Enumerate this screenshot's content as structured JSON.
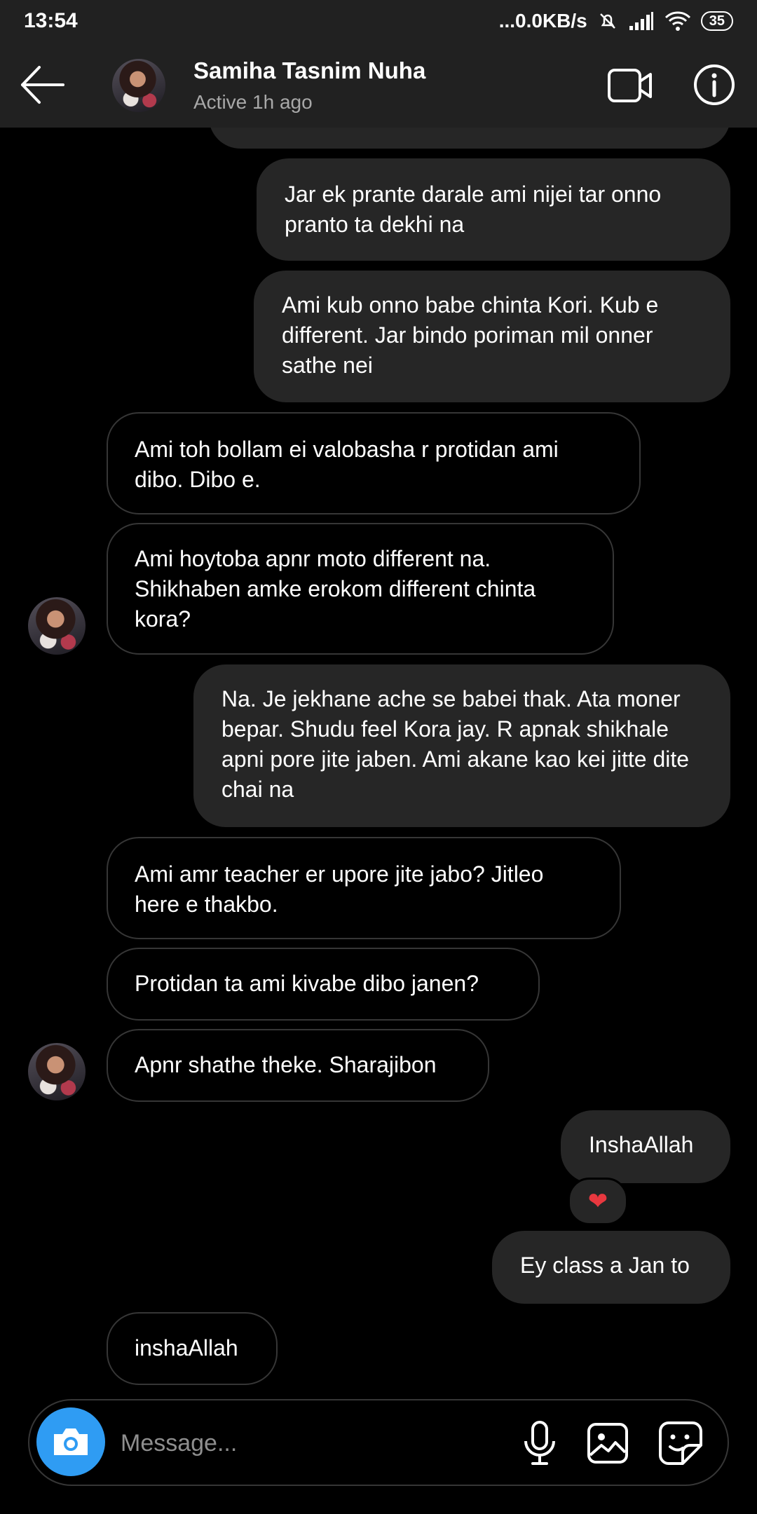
{
  "status_bar": {
    "time": "13:54",
    "network_speed": "...0.0KB/s",
    "battery": "35"
  },
  "header": {
    "contact_name": "Samiha Tasnim Nuha",
    "active_status": "Active 1h ago"
  },
  "messages": [
    {
      "direction": "outgoing",
      "text": "Jar ek prante darale ami nijei tar onno pranto ta dekhi na"
    },
    {
      "direction": "outgoing",
      "text": "Ami kub onno babe chinta Kori. Kub e different. Jar bindo poriman mil onner sathe nei"
    },
    {
      "direction": "incoming",
      "text": "Ami toh bollam ei valobasha r protidan ami dibo. Dibo e."
    },
    {
      "direction": "incoming",
      "text": "Ami hoytoba apnr moto different na. Shikhaben amke erokom different chinta kora?"
    },
    {
      "direction": "outgoing",
      "text": "Na. Je jekhane ache se babei thak. Ata moner bepar. Shudu feel Kora jay. R apnak shikhale apni pore jite jaben. Ami akane kao kei jitte dite chai na"
    },
    {
      "direction": "incoming",
      "text": "Ami amr teacher er upore jite jabo? Jitleo here e thakbo."
    },
    {
      "direction": "incoming",
      "text": "Protidan ta ami kivabe dibo janen?"
    },
    {
      "direction": "incoming",
      "text": "Apnr shathe theke. Sharajibon"
    },
    {
      "direction": "outgoing",
      "text": "InshaAllah"
    },
    {
      "direction": "outgoing",
      "text": "Ey class a Jan to"
    },
    {
      "direction": "incoming",
      "text": "inshaAllah"
    }
  ],
  "reaction": "❤",
  "composer": {
    "placeholder": "Message..."
  },
  "icons": {
    "back": "arrow-left-icon",
    "video": "video-camera-icon",
    "info": "info-icon",
    "camera": "camera-icon",
    "mic": "microphone-icon",
    "gallery": "image-icon",
    "sticker": "sticker-icon"
  },
  "colors": {
    "background": "#000000",
    "outgoing_bubble": "#262626",
    "incoming_border": "#363636",
    "camera_button": "#2f9cf3",
    "reaction_heart": "#e8383f"
  }
}
